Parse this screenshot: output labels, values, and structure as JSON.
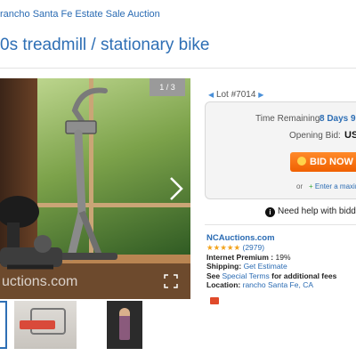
{
  "breadcrumb": "rancho Santa Fe Estate Sale Auction",
  "title": "0s treadmill / stationary bike",
  "gallery": {
    "counter": "1 / 3",
    "watermark": "uctions.com",
    "next_icon": "chevron-right-icon",
    "expand_icon": "expand-icon"
  },
  "lot": {
    "label": "Lot #7014"
  },
  "bidding": {
    "time_remaining_label": "Time Remaining:",
    "time_remaining_value": "8 Days 9",
    "opening_bid_label": "Opening Bid:",
    "opening_bid_value": "US",
    "bid_button": "BID NOW S",
    "or_text": "or",
    "max_bid_link": "Enter a maxim"
  },
  "help": {
    "text": "Need help with biddi"
  },
  "seller": {
    "name": "NCAuctions.com",
    "stars": "★★★★★",
    "rating_count": "(2979)",
    "internet_premium_label": "Internet Premium :",
    "internet_premium_value": "19%",
    "shipping_label": "Shipping:",
    "shipping_value": "Get Estimate",
    "see_text": "See",
    "special_terms": "Special Terms",
    "for_fees_text": "for additional fees",
    "location_label": "Location:",
    "location_value": "rancho Santa Fe, CA"
  },
  "colors": {
    "accent": "#2e6fb5",
    "bid_button": "#f06000",
    "stars": "#f2a21b"
  }
}
